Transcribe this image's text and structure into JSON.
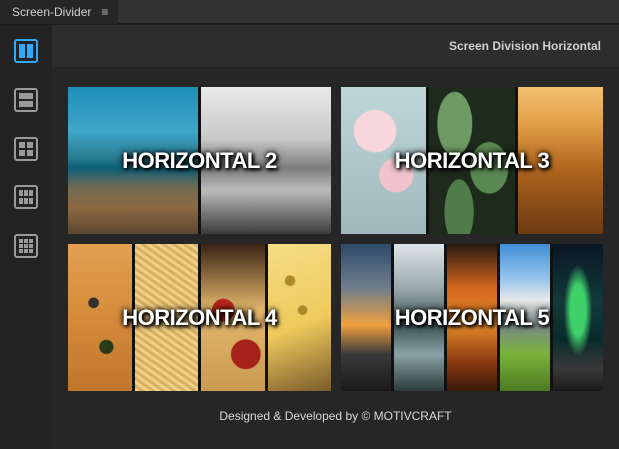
{
  "app": {
    "title": "Screen-Divider",
    "menu_glyph": "≡"
  },
  "sidebar": {
    "accent": "#31a8ff",
    "items": [
      {
        "icon": "two-columns-icon",
        "active": true
      },
      {
        "icon": "two-rows-icon",
        "active": false
      },
      {
        "icon": "four-grid-icon",
        "active": false
      },
      {
        "icon": "six-grid-icon",
        "active": false
      },
      {
        "icon": "nine-grid-icon",
        "active": false
      }
    ]
  },
  "header": {
    "title": "Screen Division Horizontal"
  },
  "cards": [
    {
      "label": "HORIZONTAL 2",
      "strips": [
        "coastal-road-photo",
        "snowy-street-photo"
      ]
    },
    {
      "label": "HORIZONTAL 3",
      "strips": [
        "cherry-blossom-photo",
        "green-leaves-photo",
        "wheat-field-photo"
      ]
    },
    {
      "label": "HORIZONTAL 4",
      "strips": [
        "pizza-photo",
        "pasta-photo",
        "pepperoni-pizza-photo",
        "cheese-photo"
      ]
    },
    {
      "label": "HORIZONTAL 5",
      "strips": [
        "sunset-coast-photo",
        "mountain-lake-photo",
        "autumn-forest-photo",
        "alpine-meadow-photo",
        "aurora-photo"
      ]
    }
  ],
  "footer": {
    "text": "Designed & Developed by © MOTIVCRAFT"
  }
}
